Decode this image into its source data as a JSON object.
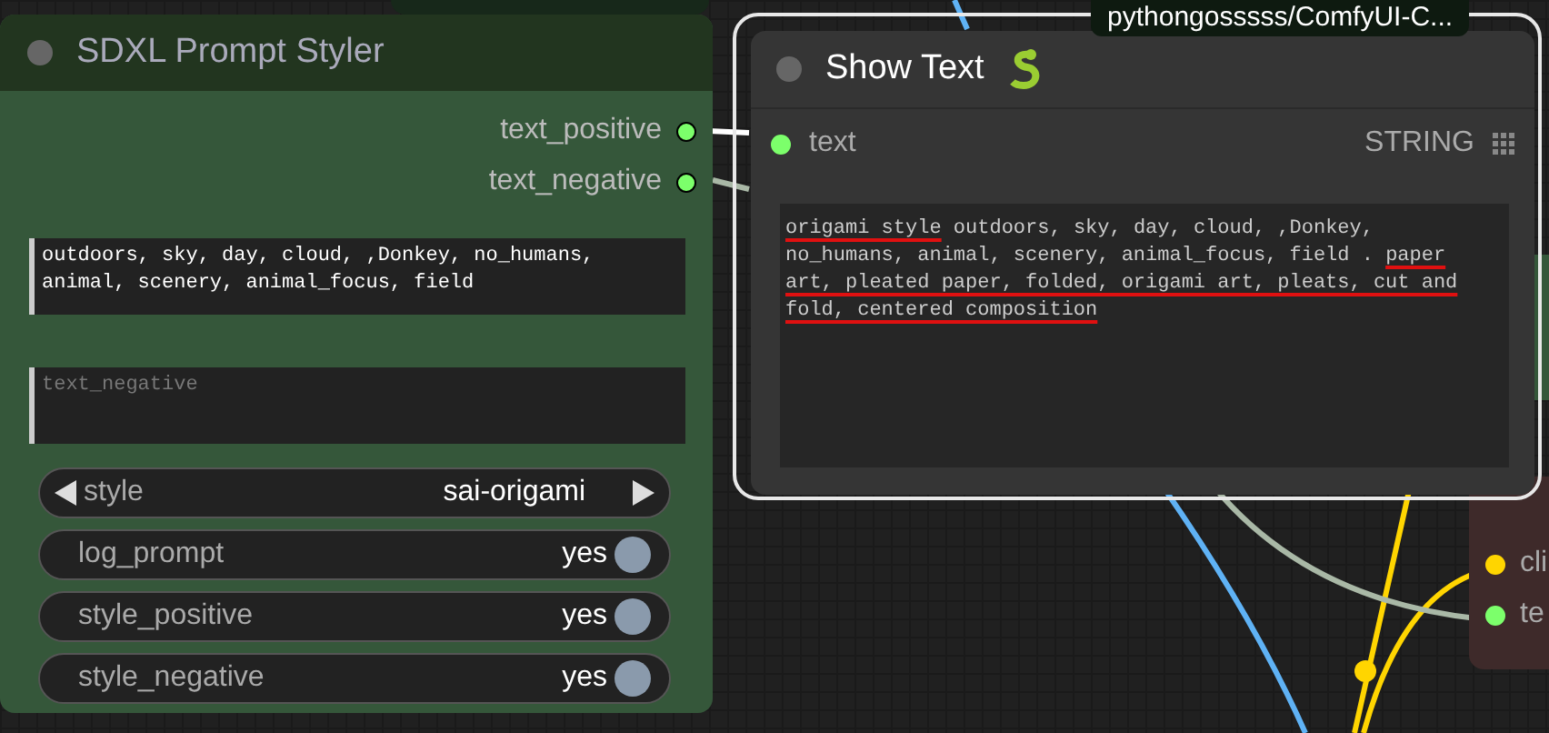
{
  "tooltip": {
    "text": "pythongosssss/ComfyUI-C..."
  },
  "styler_node": {
    "title": "SDXL Prompt Styler",
    "outputs": [
      {
        "label": "text_positive",
        "connected": true
      },
      {
        "label": "text_negative",
        "connected": true
      }
    ],
    "positive_field": {
      "value": "outdoors, sky, day, cloud, ,Donkey, no_humans, animal, scenery, animal_focus, field"
    },
    "negative_field": {
      "placeholder": "text_negative"
    },
    "widgets": [
      {
        "kind": "combo",
        "label": "style",
        "value": "sai-origami"
      },
      {
        "kind": "toggle",
        "label": "log_prompt",
        "value": "yes",
        "on": true
      },
      {
        "kind": "toggle",
        "label": "style_positive",
        "value": "yes",
        "on": true
      },
      {
        "kind": "toggle",
        "label": "style_negative",
        "value": "yes",
        "on": true
      }
    ]
  },
  "show_text_node": {
    "title": "Show Text",
    "selected": true,
    "input": {
      "label": "text",
      "type": "STRING"
    },
    "output_segments": [
      {
        "text": "origami style",
        "underlined": true
      },
      {
        "text": " outdoors, sky, day, cloud, ,Donkey, no_humans, animal, scenery, animal_focus, field . ",
        "underlined": false
      },
      {
        "text": "paper art, pleated paper, folded, origami art, pleats, cut and fold, centered composition",
        "underlined": true
      }
    ]
  },
  "side_node": {
    "inputs": [
      {
        "label": "cli",
        "color": "#ffd500"
      },
      {
        "label": "te",
        "color": "#7cff6b"
      }
    ]
  }
}
